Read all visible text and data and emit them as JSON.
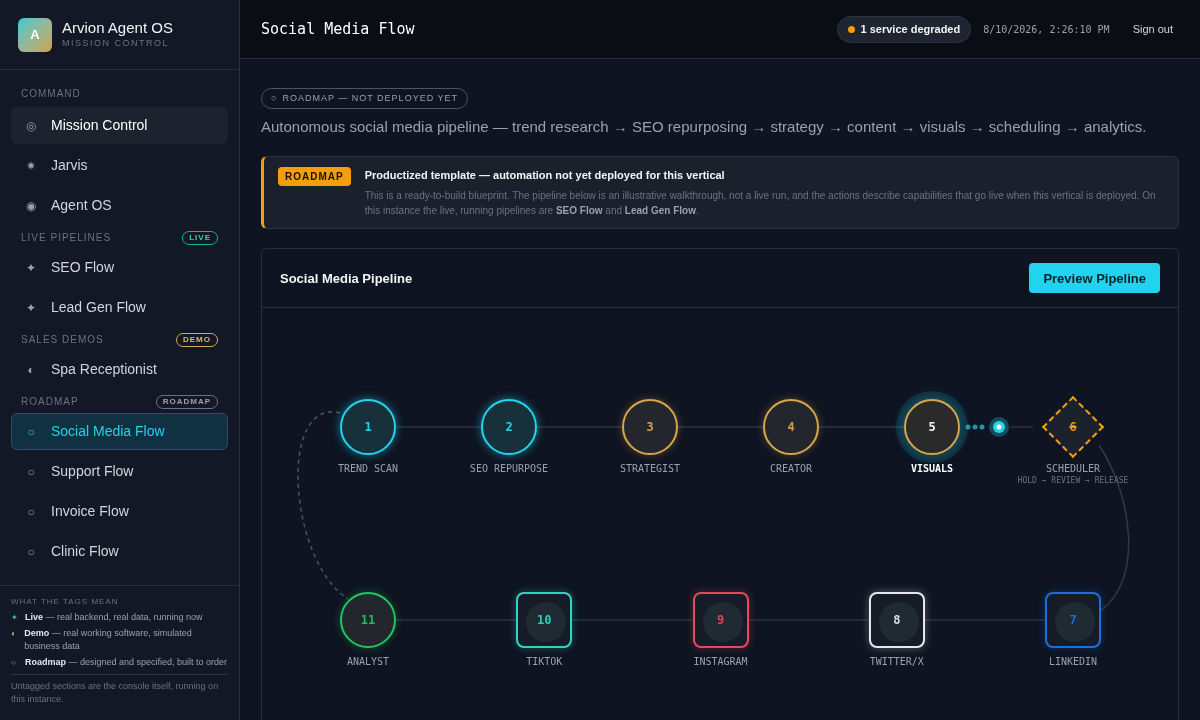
{
  "brand": {
    "logo": "A",
    "name": "Arvion Agent OS",
    "subtitle": "MISSION CONTROL"
  },
  "sidebar": {
    "sections": [
      {
        "title": "COMMAND",
        "items": [
          {
            "icon": "◎",
            "label": "Mission Control",
            "selected": false,
            "current": true
          },
          {
            "icon": "✷",
            "label": "Jarvis",
            "selected": false,
            "current": false
          },
          {
            "icon": "◉",
            "label": "Agent OS",
            "selected": false,
            "current": false
          }
        ]
      },
      {
        "title": "LIVE PIPELINES",
        "tag": {
          "text": "LIVE",
          "kind": "live"
        },
        "items": [
          {
            "icon": "✦",
            "label": "SEO Flow",
            "selected": false,
            "current": false
          },
          {
            "icon": "✦",
            "label": "Lead Gen Flow",
            "selected": false,
            "current": false
          }
        ]
      },
      {
        "title": "SALES DEMOS",
        "tag": {
          "text": "DEMO",
          "kind": "demo"
        },
        "items": [
          {
            "icon": "◐",
            "label": "Spa Receptionist",
            "selected": false,
            "current": false
          }
        ]
      },
      {
        "title": "ROADMAP",
        "tag": {
          "text": "ROADMAP",
          "kind": "roadmap"
        },
        "items": [
          {
            "icon": "○",
            "label": "Social Media Flow",
            "selected": true,
            "current": false
          },
          {
            "icon": "○",
            "label": "Support Flow",
            "selected": false,
            "current": false
          },
          {
            "icon": "○",
            "label": "Invoice Flow",
            "selected": false,
            "current": false
          },
          {
            "icon": "○",
            "label": "Clinic Flow",
            "selected": false,
            "current": false
          }
        ]
      }
    ],
    "legend": {
      "title": "WHAT THE TAGS MEAN",
      "items": [
        {
          "icon": "✦",
          "kind": "live",
          "text": "**Live** — real backend, real data, running now"
        },
        {
          "icon": "◐",
          "kind": "demo",
          "text": "**Demo** — real working software, simulated business data"
        },
        {
          "icon": "○",
          "kind": "roadmap",
          "text": "**Roadmap** — designed and specified, built to order"
        }
      ],
      "note": "Untagged sections are the console itself, running on this instance."
    }
  },
  "header": {
    "title": "Social Media Flow",
    "status": {
      "text": "1 service degraded",
      "color": "#f59e0b"
    },
    "timestamp": "8/10/2026, 2:26:10 PM",
    "sign_out": "Sign out"
  },
  "page": {
    "chip": {
      "icon": "○",
      "text": "ROADMAP — NOT DEPLOYED YET"
    },
    "description": "Autonomous social media pipeline — trend research → SEO repurposing → strategy → content → visuals → scheduling → analytics.",
    "notice": {
      "badge": "ROADMAP",
      "title": "Productized template — automation not yet deployed for this vertical",
      "body": "This is a ready-to-build blueprint. The pipeline below is an illustrative walkthrough, not a live run, and the actions describe capabilities that go live when this vertical is deployed. On this instance the live, running pipelines are **SEO Flow** and **Lead Gen Flow**."
    }
  },
  "pipeline": {
    "title": "Social Media Pipeline",
    "button": "Preview Pipeline",
    "top_row": [
      {
        "number": "1",
        "label": "TREND SCAN",
        "kind": "circle",
        "done": true,
        "active": false,
        "blocked": false,
        "color": "#22d3ee"
      },
      {
        "number": "2",
        "label": "SEO REPURPOSE",
        "kind": "circle",
        "done": true,
        "active": false,
        "blocked": false,
        "color": "#22d3ee"
      },
      {
        "number": "3",
        "label": "STRATEGIST",
        "kind": "circle",
        "done": false,
        "active": false,
        "blocked": false,
        "color": "#d9a54a"
      },
      {
        "number": "4",
        "label": "CREATOR",
        "kind": "circle",
        "done": false,
        "active": false,
        "blocked": false,
        "color": "#d9a54a"
      },
      {
        "number": "5",
        "label": "VISUALS",
        "kind": "circle",
        "done": false,
        "active": true,
        "blocked": false,
        "color": "#d9a54a"
      },
      {
        "number": "6",
        "label": "SCHEDULER",
        "sublabel": "HOLD → REVIEW → RELEASE",
        "kind": "diamond",
        "done": false,
        "active": false,
        "blocked": true,
        "color": "#f59e0b"
      }
    ],
    "bottom_row": [
      {
        "number": "11",
        "label": "ANALYST",
        "kind": "circle",
        "color": "#22c55e"
      },
      {
        "number": "10",
        "label": "TIKTOK",
        "kind": "square",
        "color": "#2dd4bf"
      },
      {
        "number": "9",
        "label": "INSTAGRAM",
        "kind": "square",
        "color": "#e5485f"
      },
      {
        "number": "8",
        "label": "TWITTER/X",
        "kind": "square",
        "color": "#e5e7eb"
      },
      {
        "number": "7",
        "label": "LINKEDIN",
        "kind": "square",
        "color": "#1d6fd8"
      }
    ]
  }
}
